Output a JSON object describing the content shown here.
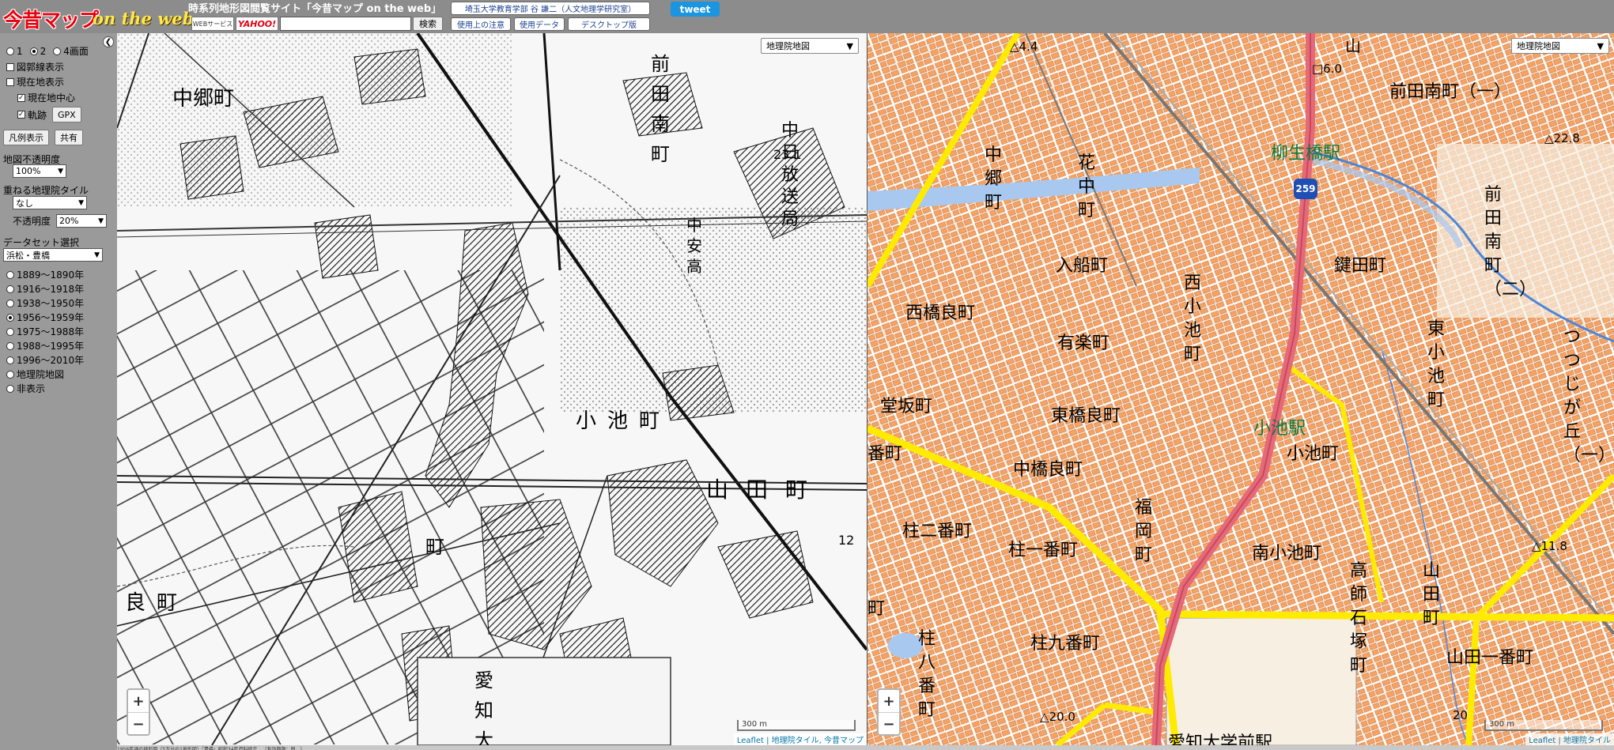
{
  "header": {
    "logo_main": "今昔マップ",
    "logo_sub": "on the web",
    "site_title": "時系列地形図閲覧サイト「今昔マップ on the web」",
    "badge_web": "WEBサービス",
    "badge_yahoo": "YAHOO!",
    "search_placeholder": "",
    "search_button": "検索",
    "author_link": "埼玉大学教育学部 谷 謙二（人文地理学研究室）",
    "usage_notes": "使用上の注意",
    "usage_data": "使用データ",
    "desktop": "デスクトップ版",
    "tweet": "tweet"
  },
  "sidebar": {
    "collapse_icon": "chevron-left-icon",
    "layout_options": [
      "1",
      "2",
      "4画面"
    ],
    "layout_selected": 1,
    "show_map_bounds": "図郭線表示",
    "show_current": "現在地表示",
    "center_current": "現在地中心",
    "track": "軌跡",
    "gpx_button": "GPX",
    "legend_button": "凡例表示",
    "share_button": "共有",
    "opacity_label": "地図不透明度",
    "opacity_value": "100%",
    "overlay_label": "重ねる地理院タイル",
    "overlay_value": "なし",
    "overlay_opacity_label": "不透明度",
    "overlay_opacity_value": "20%",
    "dataset_label": "データセット選択",
    "dataset_value": "浜松・豊橋",
    "periods": [
      "1889〜1890年",
      "1916〜1918年",
      "1938〜1950年",
      "1956〜1959年",
      "1975〜1988年",
      "1988〜1995年",
      "1996〜2010年",
      "地理院地図",
      "非表示"
    ],
    "period_selected": 3
  },
  "left_map": {
    "type_select": "地理院地図",
    "labels": [
      "中郷町",
      "前田南町",
      "中日放送局",
      "23.1",
      "中安高",
      "小池町",
      "山田町",
      "町",
      "良町",
      "愛知大",
      "12"
    ],
    "scale": "300 m",
    "attribution": "Leaflet | 地理院タイル, 今昔マップ"
  },
  "right_map": {
    "type_select": "地理院地図",
    "labels": {
      "spot_4_4": "△4.4",
      "spot_6_0": "□6.0",
      "yama": "山",
      "maeda_minami": "前田南町（一）",
      "spot_22_8": "△22.8",
      "yagyubashi": "柳生橋駅",
      "route": "259",
      "nakago": "中郷町",
      "hananaka": "花中町",
      "maeda_minami_2": "前田南町（二）",
      "irifune": "入船町",
      "kagita": "鍵田町",
      "nishi_kagira": "西橋良町",
      "nishi_koike": "西小池町",
      "yuraku": "有楽町",
      "higashi_koike": "東小池町",
      "tsutsujigaoka": "つつじが丘（一）",
      "dosaka": "堂坂町",
      "higashi_kagira": "東橋良町",
      "koike_station": "小池駅",
      "koike_cho": "小池町",
      "banmachi": "番町",
      "naka_kagira": "中橋良町",
      "fukuoka": "福岡町",
      "hashira_ni": "柱二番町",
      "hashira_ichi": "柱一番町",
      "minami_koike": "南小池町",
      "takashi_ishizuka": "高師石塚町",
      "yamada": "山田町",
      "spot_11_8": "△11.8",
      "machi": "町",
      "hashira_hachi": "柱八番町",
      "hashira_kyu": "柱九番町",
      "yamada_ichi": "山田一番町",
      "spot_20_0": "△20.0",
      "spot_20": "20",
      "aichi_daigakumae": "愛知大学前駅"
    },
    "scale": "300 m",
    "attribution": "Leaflet | 地理院タイル"
  },
  "zoom": {
    "in": "+",
    "out": "−"
  },
  "status_text": "1956年頃の地形図（5万分の1地形図）「豊橋」昭和34年資料修正…（有効期限：田…）",
  "colors": {
    "header_bg": "#8c8c8c",
    "sidebar_bg": "#9a9a9a",
    "tweet": "#1b95e0",
    "logo_red": "#e8000d",
    "logo_yellow": "#ffe94a",
    "building": "#f0a060",
    "road_yellow": "#ffeb00",
    "route_red": "#e46a7a",
    "water": "#a8c8f0",
    "station_green": "#0a7a3e"
  }
}
